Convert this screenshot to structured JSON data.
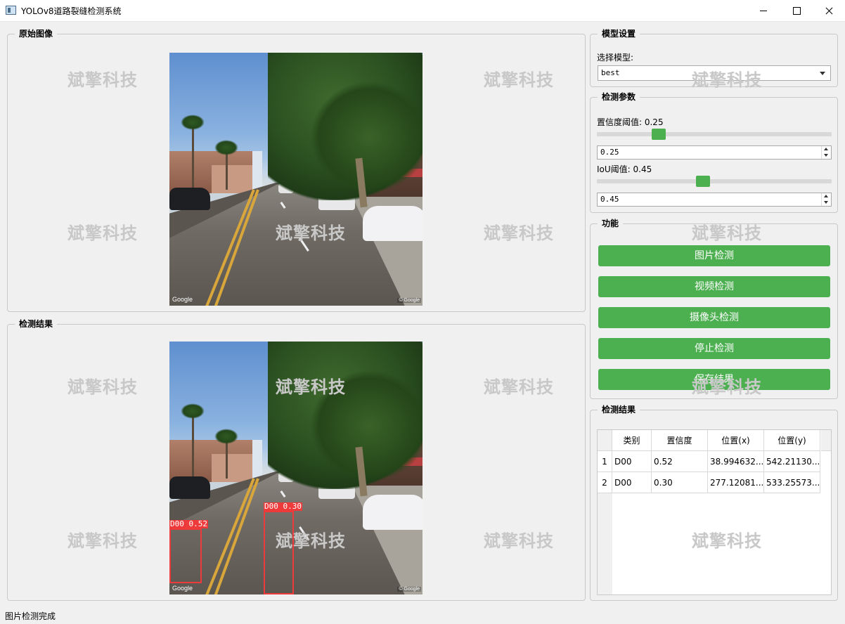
{
  "window": {
    "title": "YOLOv8道路裂缝检测系统"
  },
  "watermark": "斌擎科技",
  "original_panel": {
    "title": "原始图像",
    "image_credit": "Google",
    "image_copyright": "© Google"
  },
  "result_panel": {
    "title": "检测结果",
    "image_credit": "Google",
    "image_copyright": "© Google",
    "detections": [
      {
        "label": "D00 0.52"
      },
      {
        "label": "D00 0.30"
      }
    ]
  },
  "model_settings": {
    "title": "模型设置",
    "select_label": "选择模型:",
    "selected_model": "best"
  },
  "detect_params": {
    "title": "检测参数",
    "confidence_label": "置信度阈值: 0.25",
    "confidence_value": "0.25",
    "confidence_level": 0.25,
    "iou_label": "IoU阈值: 0.45",
    "iou_value": "0.45",
    "iou_level": 0.45
  },
  "functions": {
    "title": "功能",
    "image_detect": "图片检测",
    "video_detect": "视频检测",
    "camera_detect": "摄像头检测",
    "stop_detect": "停止检测",
    "save_result": "保存结果"
  },
  "results_table": {
    "title": "检测结果",
    "headers": [
      "类别",
      "置信度",
      "位置(x)",
      "位置(y)"
    ],
    "rows": [
      {
        "index": "1",
        "cls": "D00",
        "conf": "0.52",
        "x": "38.994632...",
        "y": "542.21130..."
      },
      {
        "index": "2",
        "cls": "D00",
        "conf": "0.30",
        "x": "277.12081...",
        "y": "533.25573..."
      }
    ]
  },
  "status": {
    "text": "图片检测完成"
  },
  "colors": {
    "accent": "#4caf50",
    "detection_box": "#ee3a3a"
  }
}
